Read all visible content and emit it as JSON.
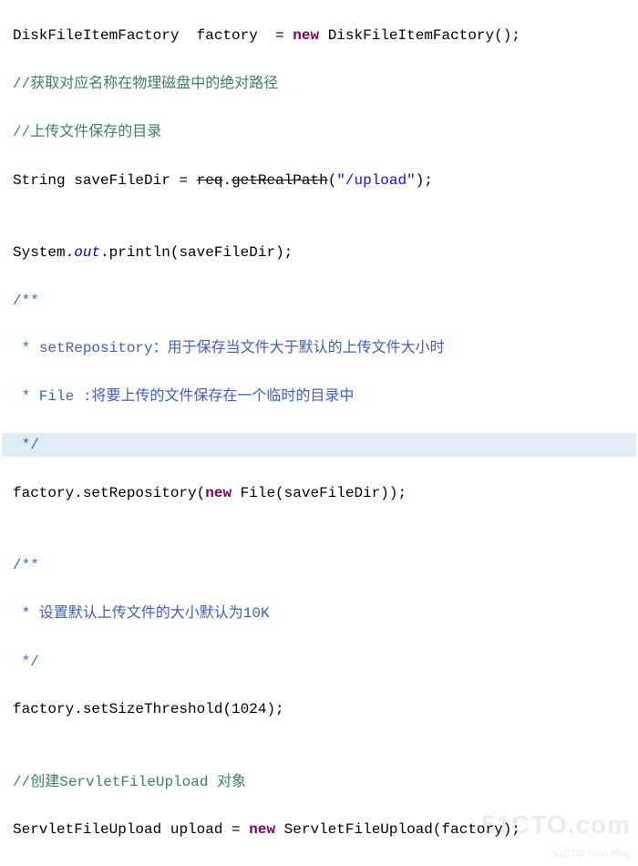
{
  "code": {
    "l1": {
      "type1": "DiskFileItemFactory",
      "sp1": "  ",
      "var": "factory",
      "sp2": "  ",
      "eq": "=",
      "sp3": " ",
      "kw_new": "new",
      "sp4": " ",
      "type2": "DiskFileItemFactory",
      "tail": "();"
    },
    "l2": "//获取对应名称在物理磁盘中的绝对路径",
    "l3": "//上传文件保存的目录",
    "l4": {
      "pre": "String saveFileDir = ",
      "obj": "req",
      "dot": ".",
      "method": "getRealPath",
      "open": "(",
      "str": "\"/upload\"",
      "close": ");"
    },
    "l5": "",
    "l6": {
      "pre": "System.",
      "out": "out",
      "post": ".println(saveFileDir);"
    },
    "l7": "/**",
    "l8": {
      "pre": " * ",
      "name": "setRepository",
      "rest": "：用于保存当文件大于默认的上传文件大小时"
    },
    "l9": " * File :将要上传的文件保存在一个临时的目录中",
    "l10": " */",
    "l11": {
      "pre": "factory.setRepository(",
      "kw_new": "new",
      "mid": " File(saveFileDir));"
    },
    "l12": "",
    "l13": "/**",
    "l14": " * 设置默认上传文件的大小默认为10K",
    "l15": " */",
    "l16": "factory.setSizeThreshold(1024);",
    "l17": "",
    "l18": {
      "pre": "//创建",
      "name": "ServletFileUpload",
      "post": " 对象"
    },
    "l19": {
      "type1": "ServletFileUpload",
      "mid": " upload = ",
      "kw_new": "new",
      "sp": " ",
      "type2": "ServletFileUpload",
      "tail": "(factory);"
    }
  },
  "watermark": {
    "big": "51CTO.com",
    "small": "51CTO Tech Blog"
  }
}
